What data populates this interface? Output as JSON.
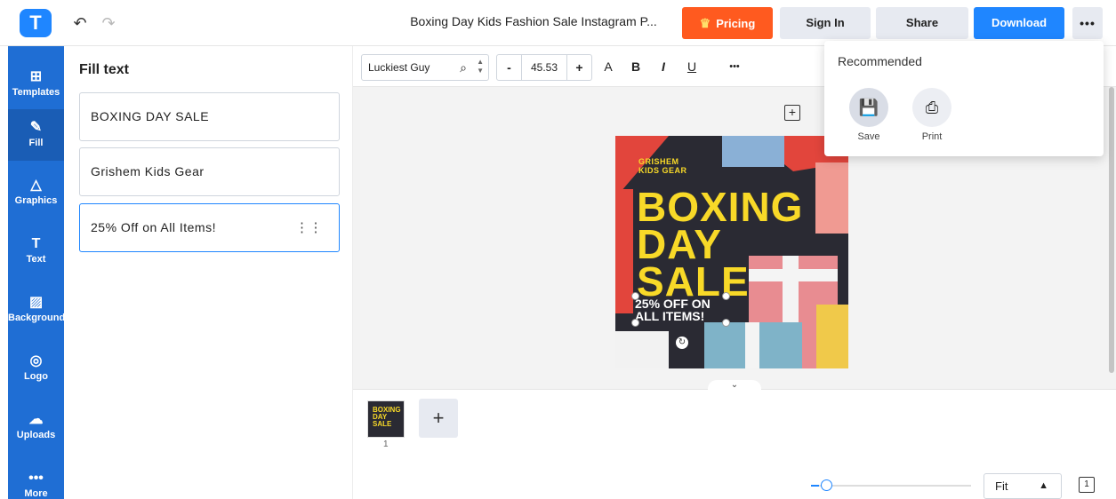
{
  "header": {
    "logo_letter": "T",
    "undo_icon": "undo-icon",
    "redo_icon": "redo-icon",
    "document_title": "Boxing Day Kids Fashion Sale Instagram P...",
    "pricing_label": "Pricing",
    "signin_label": "Sign In",
    "share_label": "Share",
    "download_label": "Download",
    "more_label": "•••",
    "brand_color": "#1f86ff",
    "pricing_color": "#ff5a1f"
  },
  "sidebar": {
    "items": [
      {
        "label": "Templates",
        "icon": "templates-icon"
      },
      {
        "label": "Fill",
        "icon": "pencil-icon"
      },
      {
        "label": "Graphics",
        "icon": "shapes-icon"
      },
      {
        "label": "Text",
        "icon": "text-icon"
      },
      {
        "label": "Background",
        "icon": "background-icon"
      },
      {
        "label": "Logo",
        "icon": "logo-icon"
      },
      {
        "label": "Uploads",
        "icon": "upload-cloud-icon"
      },
      {
        "label": "More",
        "icon": "more-icon"
      }
    ]
  },
  "panel": {
    "title": "Fill text",
    "fields": [
      {
        "value": "BOXING DAY SALE"
      },
      {
        "value": "Grishem Kids Gear"
      },
      {
        "value": "25% Off on All Items!"
      }
    ]
  },
  "toolbar": {
    "font_name": "Luckiest Guy",
    "font_size": "45.53",
    "minus": "-",
    "plus": "+",
    "case_label": "A",
    "bold_label": "B",
    "italic_label": "I",
    "underline_label": "U",
    "more_label": "•••"
  },
  "poster": {
    "brand_line1": "GRISHEM",
    "brand_line2": "KIDS GEAR",
    "line1": "BOXING",
    "line2": "DAY",
    "line3": "SALE",
    "offer_line1": "25% OFF ON",
    "offer_line2": "ALL ITEMS!"
  },
  "popup": {
    "title": "Recommended",
    "options": [
      {
        "label": "Save",
        "icon": "save-icon"
      },
      {
        "label": "Print",
        "icon": "print-icon"
      }
    ]
  },
  "bottom": {
    "page_number": "1",
    "add_page": "+",
    "zoom_value": "Fit",
    "zoom_level": 0.05
  }
}
